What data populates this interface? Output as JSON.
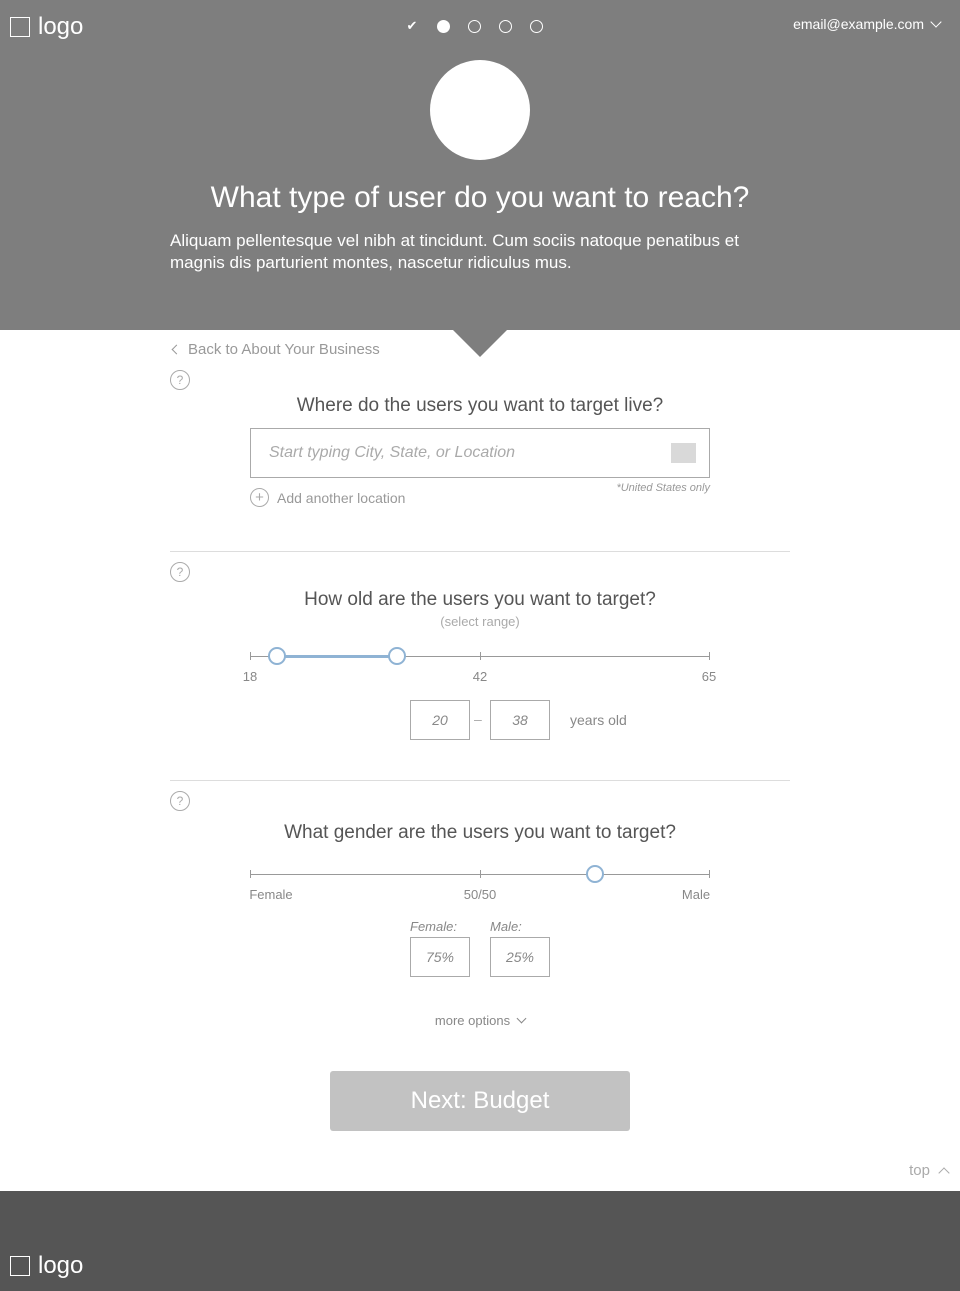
{
  "header": {
    "logo_text": "logo",
    "steps": [
      {
        "state": "done",
        "icon": "check-icon",
        "glyph": "✔"
      },
      {
        "state": "active"
      },
      {
        "state": "pending"
      },
      {
        "state": "pending"
      },
      {
        "state": "pending"
      }
    ],
    "account_email": "email@example.com",
    "title": "What type of user do you want to reach?",
    "description": "Aliquam pellentesque vel nibh at tincidunt. Cum sociis natoque penatibus et magnis dis parturient montes, nascetur ridiculus mus."
  },
  "back_link": "Back to About Your Business",
  "help_glyph": "?",
  "location": {
    "question": "Where do the users you want to target live?",
    "placeholder": "Start typing City, State, or Location",
    "value": "",
    "add_label": "Add another location",
    "add_glyph": "+",
    "note": "*United States only"
  },
  "age": {
    "question": "How old are the users you want to target?",
    "hint": "(select range)",
    "min": 18,
    "max": 65,
    "tick_labels": [
      "18",
      "42",
      "65"
    ],
    "selected_min": "20",
    "selected_max": "38",
    "dash": "–",
    "unit_label": "years old"
  },
  "gender": {
    "question": "What gender are the users you want to target?",
    "tick_labels": [
      "Female",
      "50/50",
      "Male"
    ],
    "slider_position_fraction": 0.75,
    "female_label": "Female:",
    "male_label": "Male:",
    "female_value": "75%",
    "male_value": "25%"
  },
  "more_options": "more options",
  "next_button": "Next: Budget",
  "top_link": "top",
  "footer": {
    "logo_text": "logo"
  },
  "colors": {
    "header_bg": "#7e7e7e",
    "footer_bg": "#555555",
    "slider_accent": "#8fb3d4",
    "button_bg": "#c2c2c2"
  }
}
